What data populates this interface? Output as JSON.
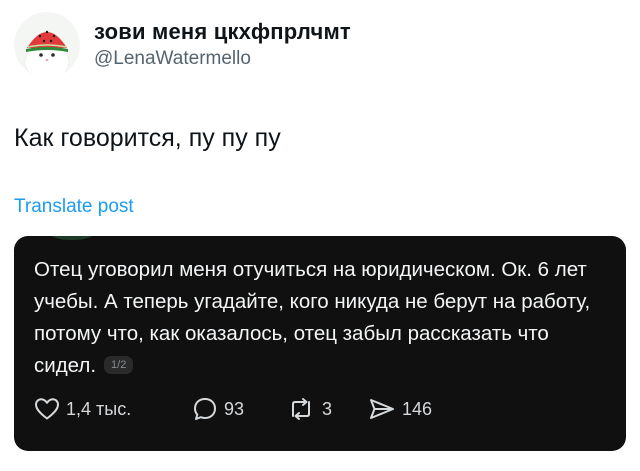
{
  "author": {
    "display_name": "зови меня цкхфпрлчмт",
    "handle": "@LenaWatermello",
    "avatar_icon": "cat-with-watermelon-helmet-avatar"
  },
  "post": {
    "text": "Как говорится, пу пу пу",
    "translate_label": "Translate post"
  },
  "embedded": {
    "text": "Отец уговорил меня отучиться на юридическом. Ок. 6 лет учебы. А теперь угадайте, кого никуда не берут на работу, потому что, как оказалось, отец забыл рассказать что сидел.",
    "page_indicator": "1/2",
    "actions": {
      "likes": "1,4 тыс.",
      "replies": "93",
      "reposts": "3",
      "shares": "146"
    }
  },
  "colors": {
    "link": "#1d9bf0",
    "handle": "#536471",
    "card_bg": "#101010",
    "card_text": "#f3f5f7"
  }
}
